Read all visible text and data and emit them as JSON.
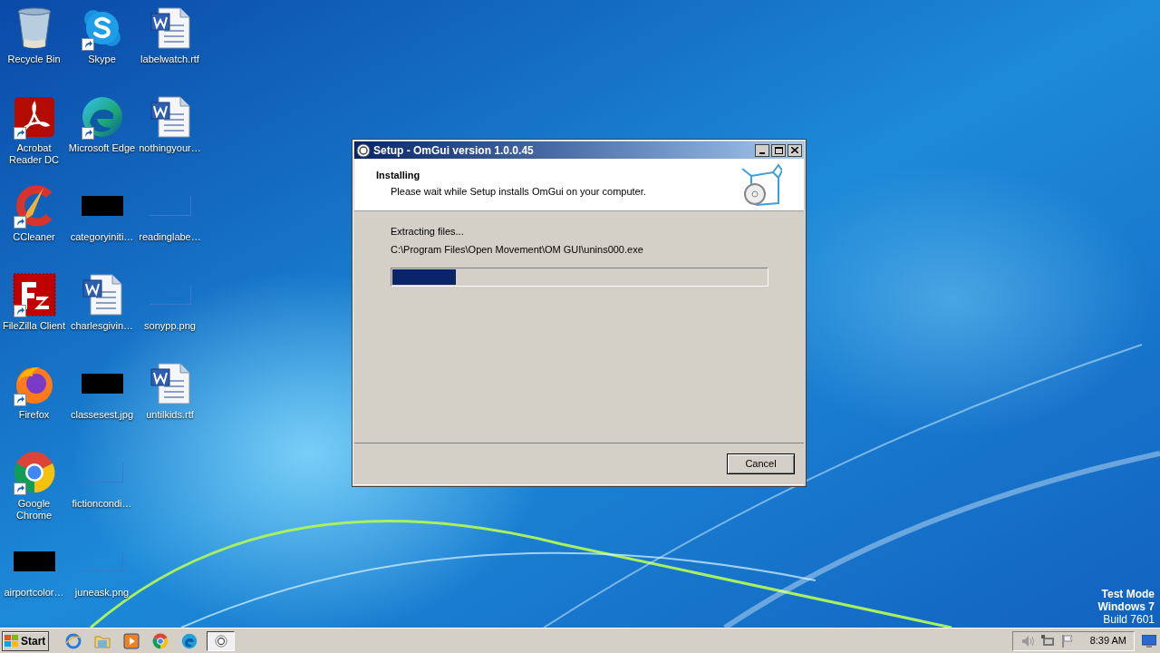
{
  "desktop": {
    "columns": [
      [
        {
          "label": "Recycle Bin",
          "kind": "recycle",
          "shortcut": false
        },
        {
          "label": "Acrobat Reader DC",
          "kind": "acrobat",
          "shortcut": true
        },
        {
          "label": "CCleaner",
          "kind": "ccleaner",
          "shortcut": true
        },
        {
          "label": "FileZilla Client",
          "kind": "filezilla",
          "shortcut": true
        },
        {
          "label": "Firefox",
          "kind": "firefox",
          "shortcut": true
        },
        {
          "label": "Google Chrome",
          "kind": "chrome",
          "shortcut": true
        },
        {
          "label": "airportcolor…",
          "kind": "redacted",
          "shortcut": false
        }
      ],
      [
        {
          "label": "Skype",
          "kind": "skype",
          "shortcut": true
        },
        {
          "label": "Microsoft Edge",
          "kind": "edge",
          "shortcut": true
        },
        {
          "label": "categoryiniti…",
          "kind": "redacted",
          "shortcut": false
        },
        {
          "label": "charlesgivin…",
          "kind": "word",
          "shortcut": false
        },
        {
          "label": "classesest.jpg",
          "kind": "redacted",
          "shortcut": false
        },
        {
          "label": "fictioncondi…",
          "kind": "blank",
          "shortcut": false
        },
        {
          "label": "juneask.png",
          "kind": "blank",
          "shortcut": false
        }
      ],
      [
        {
          "label": "labelwatch.rtf",
          "kind": "word",
          "shortcut": false
        },
        {
          "label": "nothingyour…",
          "kind": "word",
          "shortcut": false
        },
        {
          "label": "readinglabe…",
          "kind": "blank",
          "shortcut": false
        },
        {
          "label": "sonypp.png",
          "kind": "blank",
          "shortcut": false
        },
        {
          "label": "untilkids.rtf",
          "kind": "word",
          "shortcut": false
        }
      ]
    ]
  },
  "dialog": {
    "title": "Setup - OmGui version 1.0.0.45",
    "heading": "Installing",
    "subtitle": "Please wait while Setup installs OmGui on your computer.",
    "status": "Extracting files...",
    "path": "C:\\Program Files\\Open Movement\\OM GUI\\unins000.exe",
    "progress": {
      "level": 0.17
    },
    "buttons": [
      "Cancel"
    ]
  },
  "system_text": [
    "Test Mode",
    "Windows 7",
    "Build 7601"
  ],
  "taskbar": {
    "start": "Start",
    "clock": "8:39 AM"
  }
}
